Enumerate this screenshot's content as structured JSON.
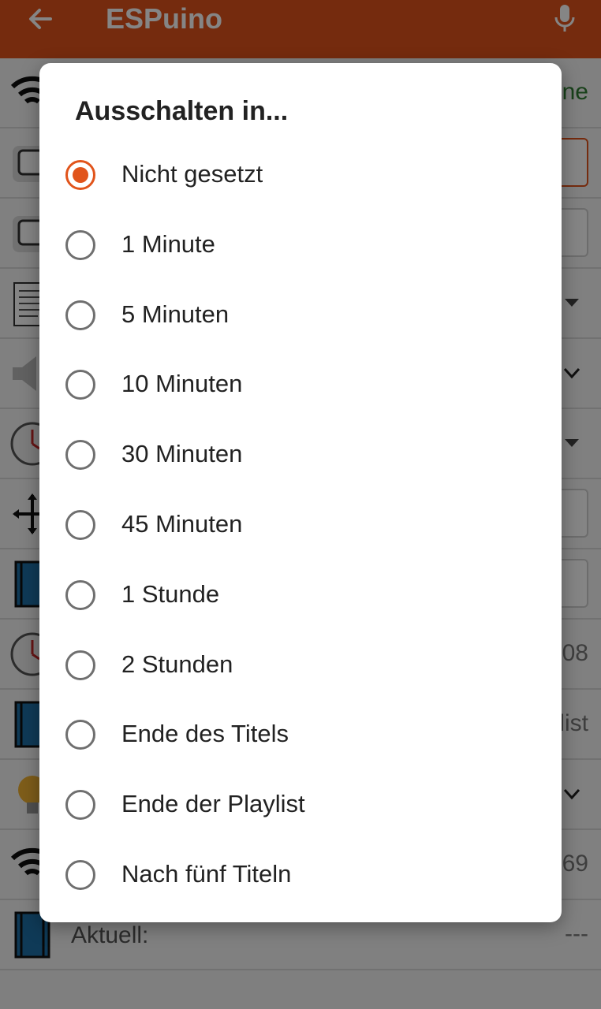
{
  "appbar": {
    "title": "ESPuino",
    "back_icon": "arrow-left-icon",
    "mic_icon": "microphone-icon",
    "color": "#e1541b"
  },
  "background_rows": [
    {
      "icon": "wifi-icon",
      "right_text": "ne"
    },
    {
      "icon": "checkbox-icon",
      "right_text": ""
    },
    {
      "icon": "checkbox-icon",
      "right_text": ""
    },
    {
      "icon": "document-icon",
      "right_text": ""
    },
    {
      "icon": "speaker-icon",
      "right_text": ""
    },
    {
      "icon": "clock-icon",
      "right_text": ""
    },
    {
      "icon": "move-arrows-icon",
      "right_text": ""
    },
    {
      "icon": "film-icon",
      "right_text": ""
    },
    {
      "icon": "clock-icon",
      "right_text": "08"
    },
    {
      "icon": "film-icon",
      "right_text": "list"
    },
    {
      "icon": "lightbulb-icon",
      "right_text": ""
    },
    {
      "icon": "wifi-icon",
      "right_text": "69"
    },
    {
      "icon": "film-icon",
      "label": "Aktuell:",
      "right_text": "---"
    }
  ],
  "dialog": {
    "title": "Ausschalten in...",
    "accent": "#e1541b",
    "selected_index": 0,
    "options": [
      {
        "label": "Nicht gesetzt"
      },
      {
        "label": "1 Minute"
      },
      {
        "label": "5 Minuten"
      },
      {
        "label": "10 Minuten"
      },
      {
        "label": "30 Minuten"
      },
      {
        "label": "45 Minuten"
      },
      {
        "label": "1 Stunde"
      },
      {
        "label": "2 Stunden"
      },
      {
        "label": "Ende des Titels"
      },
      {
        "label": "Ende der Playlist"
      },
      {
        "label": "Nach fünf Titeln"
      }
    ]
  }
}
